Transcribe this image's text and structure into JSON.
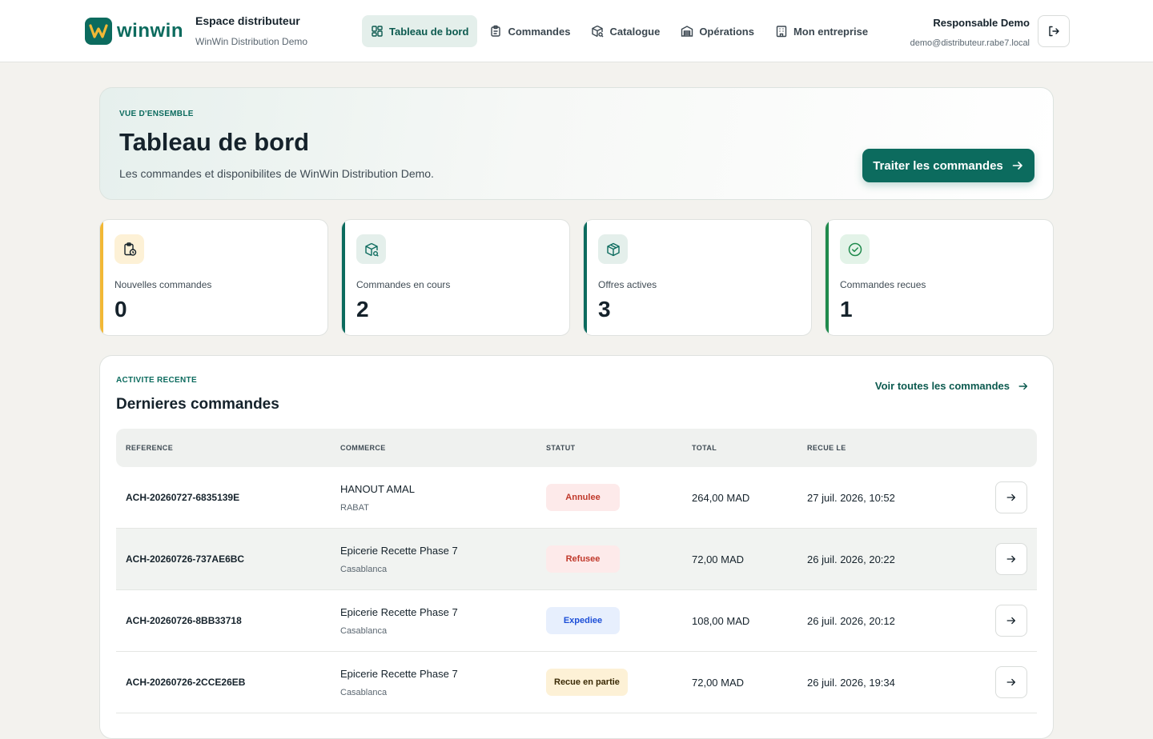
{
  "header": {
    "logo_text": "winwin",
    "space_title": "Espace distributeur",
    "company_name": "WinWin Distribution Demo",
    "nav": [
      {
        "label": "Tableau de bord",
        "icon": "dashboard-icon",
        "active": true
      },
      {
        "label": "Commandes",
        "icon": "clipboard-icon",
        "active": false
      },
      {
        "label": "Catalogue",
        "icon": "box-search-icon",
        "active": false
      },
      {
        "label": "Opérations",
        "icon": "warehouse-icon",
        "active": false
      },
      {
        "label": "Mon entreprise",
        "icon": "building-icon",
        "active": false
      }
    ],
    "user_name": "Responsable Demo",
    "user_email": "demo@distributeur.rabe7.local",
    "logout_icon": "logout-icon"
  },
  "hero": {
    "eyebrow": "VUE D'ENSEMBLE",
    "title": "Tableau de bord",
    "subtitle": "Les commandes et disponibilites de WinWin Distribution Demo.",
    "cta_label": "Traiter les commandes"
  },
  "stats": [
    {
      "label": "Nouvelles commandes",
      "value": "0",
      "icon": "clipboard-clock-icon",
      "accent": "#f2b836",
      "icon_bg": "#fdf1d6"
    },
    {
      "label": "Commandes en cours",
      "value": "2",
      "icon": "box-search-icon",
      "accent": "#0c6b5e",
      "icon_bg": "#e4efeb"
    },
    {
      "label": "Offres actives",
      "value": "3",
      "icon": "box-check-icon",
      "accent": "#0c6b5e",
      "icon_bg": "#e4efeb"
    },
    {
      "label": "Commandes recues",
      "value": "1",
      "icon": "check-circle-icon",
      "accent": "#1f8a4c",
      "icon_bg": "#e3f3e8"
    }
  ],
  "orders": {
    "eyebrow": "ACTIVITE RECENTE",
    "title": "Dernieres commandes",
    "see_all": "Voir toutes les commandes",
    "columns": [
      "REFERENCE",
      "COMMERCE",
      "STATUT",
      "TOTAL",
      "RECUE LE"
    ],
    "rows": [
      {
        "ref": "ACH-20260727-6835139E",
        "shop": "HANOUT AMAL",
        "city": "RABAT",
        "status": "Annulee",
        "status_color": "#c0392b",
        "status_bg": "#fdeaea",
        "total": "264,00 MAD",
        "date": "27 juil. 2026, 10:52"
      },
      {
        "ref": "ACH-20260726-737AE6BC",
        "shop": "Epicerie Recette Phase 7",
        "city": "Casablanca",
        "status": "Refusee",
        "status_color": "#c0392b",
        "status_bg": "#fdeaea",
        "total": "72,00 MAD",
        "date": "26 juil. 2026, 20:22"
      },
      {
        "ref": "ACH-20260726-8BB33718",
        "shop": "Epicerie Recette Phase 7",
        "city": "Casablanca",
        "status": "Expediee",
        "status_color": "#1d4fd8",
        "status_bg": "#e7effd",
        "total": "108,00 MAD",
        "date": "26 juil. 2026, 20:12"
      },
      {
        "ref": "ACH-20260726-2CCE26EB",
        "shop": "Epicerie Recette Phase 7",
        "city": "Casablanca",
        "status": "Recue en partie",
        "status_color": "#3a2a05",
        "status_bg": "#fdf1d6",
        "total": "72,00 MAD",
        "date": "26 juil. 2026, 19:34"
      }
    ]
  }
}
